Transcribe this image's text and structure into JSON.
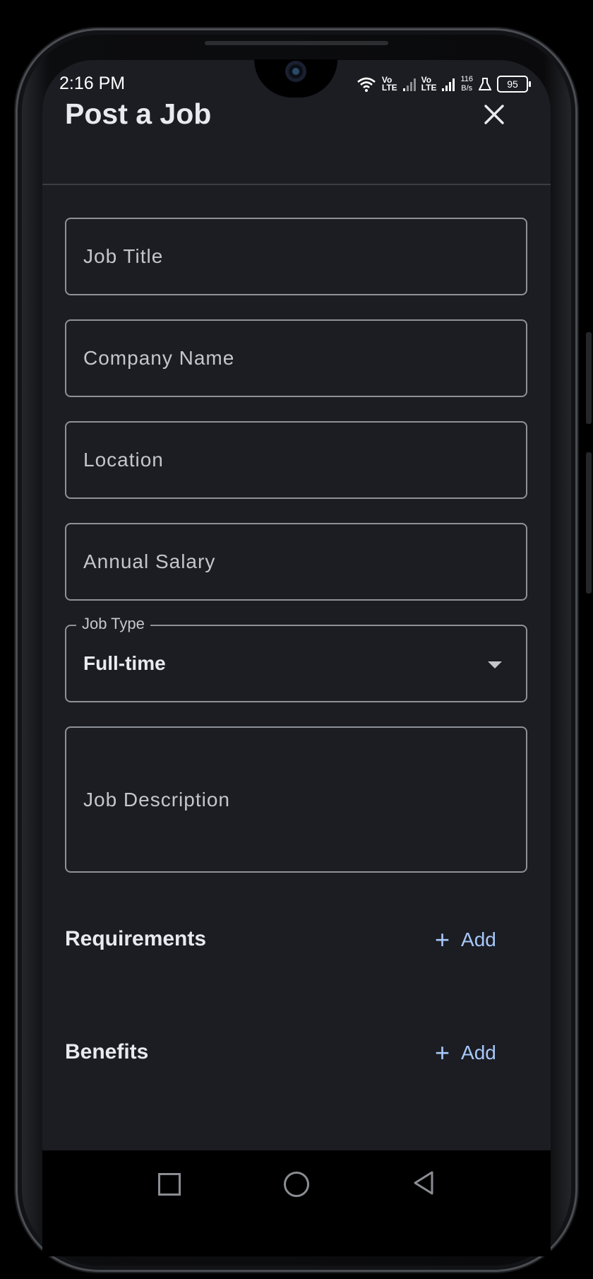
{
  "status_bar": {
    "time": "2:16 PM",
    "network1_top": "Vo",
    "network1_bottom": "LTE",
    "network2_top": "Vo",
    "network2_bottom": "LTE",
    "speed_value": "116",
    "speed_unit": "B/s",
    "battery": "95",
    "icons": [
      "wifi-icon",
      "signal-icon",
      "signal-icon",
      "flask-icon",
      "battery-icon"
    ]
  },
  "header": {
    "title": "Post a Job",
    "close_icon": "close-icon"
  },
  "form": {
    "job_title_placeholder": "Job Title",
    "company_name_placeholder": "Company Name",
    "location_placeholder": "Location",
    "annual_salary_placeholder": "Annual Salary",
    "job_type": {
      "label": "Job Type",
      "selected": "Full-time"
    },
    "job_description_placeholder": "Job Description"
  },
  "sections": {
    "requirements": {
      "label": "Requirements",
      "add_label": "Add"
    },
    "benefits": {
      "label": "Benefits",
      "add_label": "Add"
    }
  },
  "colors": {
    "background": "#1b1d22",
    "text": "#e8eaf0",
    "placeholder": "#c3c6cd",
    "outline": "#8e9198",
    "accent": "#a8c7fa"
  },
  "nav_bar": {
    "icons": [
      "recents-square-icon",
      "home-circle-icon",
      "back-triangle-icon"
    ]
  }
}
